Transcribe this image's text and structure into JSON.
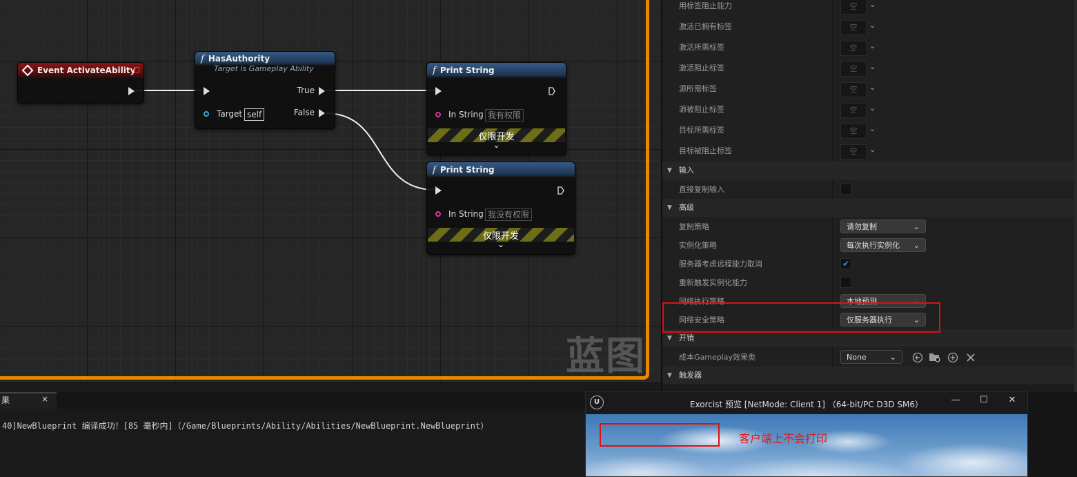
{
  "graph": {
    "watermark": "蓝图",
    "event_node": {
      "title": "Event ActivateAbility"
    },
    "has_authority": {
      "title": "HasAuthority",
      "subtitle": "Target is Gameplay Ability",
      "true_label": "True",
      "false_label": "False",
      "target_label": "Target",
      "target_value": "self"
    },
    "print_1": {
      "title": "Print String",
      "in_label": "In String",
      "in_value": "我有权限",
      "dev_label": "仅限开发"
    },
    "print_2": {
      "title": "Print String",
      "in_label": "In String",
      "in_value": "我没有权限",
      "dev_label": "仅限开发"
    },
    "function_glyph": "f",
    "expand_glyph": "⌄"
  },
  "details": {
    "tag_rows": [
      {
        "label": "用标签阻止能力",
        "value": "空"
      },
      {
        "label": "激活已拥有标签",
        "value": "空"
      },
      {
        "label": "激活所需标签",
        "value": "空"
      },
      {
        "label": "激活阻止标签",
        "value": "空"
      },
      {
        "label": "源所需标签",
        "value": "空"
      },
      {
        "label": "源被阻止标签",
        "value": "空"
      },
      {
        "label": "目标所需标签",
        "value": "空"
      },
      {
        "label": "目标被阻止标签",
        "value": "空"
      }
    ],
    "sections": {
      "input": "输入",
      "advanced": "高级",
      "cost": "开销",
      "triggers": "触发器"
    },
    "input_rows": [
      {
        "label": "直接复制输入",
        "checked": false
      }
    ],
    "advanced_rows": {
      "replication_policy": {
        "label": "复制策略",
        "value": "请勿复制"
      },
      "instancing_policy": {
        "label": "实例化策略",
        "value": "每次执行实例化"
      },
      "server_respects_cancel": {
        "label": "服务器考虑远程能力取消",
        "checked": true
      },
      "retrigger_instanced": {
        "label": "重新触发实例化能力",
        "checked": false
      },
      "net_execution_policy": {
        "label": "网络执行策略",
        "value": "本地预测"
      },
      "net_security_policy": {
        "label": "网络安全策略",
        "value": "仅服务器执行"
      }
    },
    "cost_row": {
      "label": "成本Gameplay效果类",
      "value": "None"
    },
    "check_glyph": "✔",
    "chevron_glyph": "⌄"
  },
  "log": {
    "tab_label": "果",
    "close_glyph": "×",
    "line": "40]NewBlueprint 编译成功！[85 毫秒内]（/Game/Blueprints/Ability/Abilities/NewBlueprint.NewBlueprint）"
  },
  "preview": {
    "logo": "U",
    "title": "Exorcist 预览 [NetMode: Client 1]  （64-bit/PC D3D SM6）",
    "minimize": "—",
    "maximize": "☐",
    "close": "✕",
    "note": "客户端上不会打印"
  },
  "colors": {
    "accent_border": "#e78a00",
    "annotation_red": "#e01010",
    "check_blue": "#3a8bd8"
  }
}
